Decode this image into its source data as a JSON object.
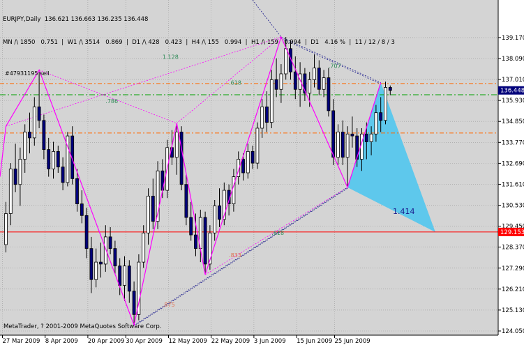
{
  "header": {
    "line1": "EURJPY,Daily  136.621 136.663 136.235 136.448",
    "line2": "MN /\\ 1850   0.751  |  W1 /\\ 3514   0.869  |  D1 /\\ 428   0.423  |  H4 /\\ 155   0.994  |  H1 /\\ 159   0.994  |  D1   4.16 %  |  11 / 12 / 8 / 3"
  },
  "copyright": "MetaTrader, ? 2001-2009 MetaQuotes Software Corp.",
  "order_label": "#47931195 sell",
  "colors": {
    "background_plot": "#d4d4d4",
    "grid": "#9a9a9a",
    "bull_candle": "#ffffff",
    "bear_candle": "#00007a",
    "pattern_line": "#ff00ff",
    "projection_fill": "#5ec8ec",
    "current_price_bg": "#00007a",
    "red_level_bg": "#ff0000",
    "orange_dash": "#ff6a00",
    "green_dash": "#00a000"
  },
  "chart_data": {
    "type": "candlestick",
    "symbol": "EURJPY",
    "timeframe": "Daily",
    "ylim": [
      124.05,
      140.1
    ],
    "y_ticks": [
      "139.170",
      "138.090",
      "137.010",
      "135.930",
      "134.850",
      "133.770",
      "132.690",
      "131.610",
      "130.530",
      "129.450",
      "128.370",
      "127.290",
      "126.210",
      "125.130",
      "124.050"
    ],
    "x_ticks": [
      "27 Mar 2009",
      "8 Apr 2009",
      "20 Apr 2009",
      "30 Apr 2009",
      "12 May 2009",
      "22 May 2009",
      "3 Jun 2009",
      "15 Jun 2009",
      "25 Jun 2009"
    ],
    "current_price": "136.448",
    "red_level": "129.153",
    "levels": {
      "red": 129.153,
      "orange_upper": 136.8,
      "orange_lower": 134.25,
      "green": 136.22
    },
    "fib_labels": [
      {
        "text": "1.128",
        "price": 138.08,
        "bar": 33
      },
      {
        "text": ".707",
        "price": 137.6,
        "bar": 68
      },
      {
        "text": ".618",
        "price": 136.75,
        "bar": 47
      },
      {
        "text": ".786",
        "price": 135.8,
        "bar": 21
      },
      {
        "text": ".618",
        "price": 129.0,
        "bar": 56
      },
      {
        "text": ".833",
        "price": 127.85,
        "bar": 47
      },
      {
        "text": ".875",
        "price": 125.3,
        "bar": 33
      }
    ],
    "projection_label": "1.414",
    "zigzag": [
      {
        "bar": 0,
        "price": 134.6
      },
      {
        "bar": 7,
        "price": 137.5
      },
      {
        "bar": 27,
        "price": 124.35
      },
      {
        "bar": 36,
        "price": 134.75
      },
      {
        "bar": 42,
        "price": 126.95
      },
      {
        "bar": 58,
        "price": 139.2
      },
      {
        "bar": 72,
        "price": 131.45
      },
      {
        "bar": 79,
        "price": 136.85
      }
    ],
    "projection_triangle": [
      {
        "bar": 72,
        "price": 131.45
      },
      {
        "bar": 79,
        "price": 136.85
      },
      {
        "bar": 90.5,
        "price": 129.15
      }
    ],
    "candles": [
      {
        "o": 128.5,
        "h": 130.7,
        "l": 128.1,
        "c": 130.1
      },
      {
        "o": 130.1,
        "h": 132.7,
        "l": 129.5,
        "c": 132.4
      },
      {
        "o": 132.4,
        "h": 133.7,
        "l": 131.2,
        "c": 131.6
      },
      {
        "o": 131.6,
        "h": 133.5,
        "l": 130.5,
        "c": 132.9
      },
      {
        "o": 132.9,
        "h": 134.7,
        "l": 132.2,
        "c": 134.3
      },
      {
        "o": 134.3,
        "h": 135.3,
        "l": 133.2,
        "c": 134.0
      },
      {
        "o": 134.0,
        "h": 136.1,
        "l": 133.6,
        "c": 135.6
      },
      {
        "o": 135.6,
        "h": 137.4,
        "l": 134.5,
        "c": 134.9
      },
      {
        "o": 134.9,
        "h": 135.2,
        "l": 132.9,
        "c": 133.4
      },
      {
        "o": 133.4,
        "h": 134.0,
        "l": 132.0,
        "c": 132.4
      },
      {
        "o": 132.4,
        "h": 133.8,
        "l": 131.9,
        "c": 133.3
      },
      {
        "o": 133.3,
        "h": 133.6,
        "l": 132.2,
        "c": 132.5
      },
      {
        "o": 132.5,
        "h": 133.0,
        "l": 131.3,
        "c": 131.7
      },
      {
        "o": 131.7,
        "h": 134.3,
        "l": 131.5,
        "c": 134.1
      },
      {
        "o": 134.1,
        "h": 134.6,
        "l": 131.6,
        "c": 131.9
      },
      {
        "o": 131.9,
        "h": 132.4,
        "l": 130.2,
        "c": 130.6
      },
      {
        "o": 130.6,
        "h": 131.3,
        "l": 129.6,
        "c": 130.0
      },
      {
        "o": 130.0,
        "h": 130.4,
        "l": 127.8,
        "c": 128.3
      },
      {
        "o": 128.3,
        "h": 128.9,
        "l": 126.0,
        "c": 126.7
      },
      {
        "o": 126.7,
        "h": 128.3,
        "l": 126.3,
        "c": 127.6
      },
      {
        "o": 127.6,
        "h": 128.6,
        "l": 126.8,
        "c": 127.5
      },
      {
        "o": 127.5,
        "h": 129.5,
        "l": 127.1,
        "c": 128.9
      },
      {
        "o": 128.9,
        "h": 129.4,
        "l": 128.0,
        "c": 128.3
      },
      {
        "o": 128.3,
        "h": 128.7,
        "l": 127.0,
        "c": 127.4
      },
      {
        "o": 127.4,
        "h": 127.8,
        "l": 125.9,
        "c": 126.4
      },
      {
        "o": 126.4,
        "h": 127.9,
        "l": 125.6,
        "c": 127.4
      },
      {
        "o": 127.4,
        "h": 127.7,
        "l": 125.5,
        "c": 126.1
      },
      {
        "o": 126.1,
        "h": 126.6,
        "l": 124.4,
        "c": 124.9
      },
      {
        "o": 124.9,
        "h": 128.0,
        "l": 124.6,
        "c": 127.6
      },
      {
        "o": 127.6,
        "h": 129.5,
        "l": 127.3,
        "c": 129.1
      },
      {
        "o": 129.1,
        "h": 131.4,
        "l": 128.5,
        "c": 131.0
      },
      {
        "o": 131.0,
        "h": 131.9,
        "l": 129.3,
        "c": 129.7
      },
      {
        "o": 129.7,
        "h": 132.8,
        "l": 129.3,
        "c": 132.3
      },
      {
        "o": 132.3,
        "h": 132.9,
        "l": 130.9,
        "c": 131.3
      },
      {
        "o": 131.3,
        "h": 133.9,
        "l": 130.9,
        "c": 133.5
      },
      {
        "o": 133.5,
        "h": 134.4,
        "l": 132.6,
        "c": 133.0
      },
      {
        "o": 133.0,
        "h": 134.7,
        "l": 132.1,
        "c": 134.3
      },
      {
        "o": 134.3,
        "h": 134.6,
        "l": 131.3,
        "c": 131.6
      },
      {
        "o": 131.6,
        "h": 132.1,
        "l": 129.5,
        "c": 129.9
      },
      {
        "o": 129.9,
        "h": 130.7,
        "l": 128.7,
        "c": 129.0
      },
      {
        "o": 129.0,
        "h": 130.1,
        "l": 127.9,
        "c": 128.3
      },
      {
        "o": 128.3,
        "h": 130.3,
        "l": 127.6,
        "c": 129.9
      },
      {
        "o": 129.9,
        "h": 130.2,
        "l": 127.0,
        "c": 127.5
      },
      {
        "o": 127.5,
        "h": 129.5,
        "l": 127.2,
        "c": 129.1
      },
      {
        "o": 129.1,
        "h": 130.8,
        "l": 128.7,
        "c": 130.5
      },
      {
        "o": 130.5,
        "h": 131.4,
        "l": 129.4,
        "c": 129.8
      },
      {
        "o": 129.8,
        "h": 131.7,
        "l": 129.5,
        "c": 131.3
      },
      {
        "o": 131.3,
        "h": 131.6,
        "l": 130.0,
        "c": 130.6
      },
      {
        "o": 130.6,
        "h": 132.4,
        "l": 130.2,
        "c": 132.0
      },
      {
        "o": 132.0,
        "h": 133.3,
        "l": 131.6,
        "c": 132.9
      },
      {
        "o": 132.9,
        "h": 133.2,
        "l": 131.8,
        "c": 132.2
      },
      {
        "o": 132.2,
        "h": 133.7,
        "l": 131.9,
        "c": 133.3
      },
      {
        "o": 133.3,
        "h": 133.6,
        "l": 132.4,
        "c": 132.7
      },
      {
        "o": 132.7,
        "h": 134.8,
        "l": 132.4,
        "c": 134.5
      },
      {
        "o": 134.5,
        "h": 136.0,
        "l": 134.0,
        "c": 135.6
      },
      {
        "o": 135.6,
        "h": 136.4,
        "l": 134.3,
        "c": 134.8
      },
      {
        "o": 134.8,
        "h": 137.5,
        "l": 134.5,
        "c": 137.0
      },
      {
        "o": 137.0,
        "h": 138.1,
        "l": 136.1,
        "c": 136.5
      },
      {
        "o": 136.5,
        "h": 137.8,
        "l": 135.8,
        "c": 137.3
      },
      {
        "o": 137.3,
        "h": 139.2,
        "l": 137.0,
        "c": 138.6
      },
      {
        "o": 138.6,
        "h": 139.0,
        "l": 137.0,
        "c": 137.4
      },
      {
        "o": 137.4,
        "h": 138.2,
        "l": 136.0,
        "c": 136.5
      },
      {
        "o": 136.5,
        "h": 137.9,
        "l": 135.6,
        "c": 137.3
      },
      {
        "o": 137.3,
        "h": 137.6,
        "l": 135.9,
        "c": 136.3
      },
      {
        "o": 136.3,
        "h": 137.4,
        "l": 135.6,
        "c": 137.0
      },
      {
        "o": 137.0,
        "h": 138.3,
        "l": 136.6,
        "c": 137.6
      },
      {
        "o": 137.6,
        "h": 138.0,
        "l": 136.2,
        "c": 136.5
      },
      {
        "o": 136.5,
        "h": 137.5,
        "l": 136.1,
        "c": 137.1
      },
      {
        "o": 137.1,
        "h": 137.6,
        "l": 135.1,
        "c": 135.4
      },
      {
        "o": 135.4,
        "h": 136.0,
        "l": 132.6,
        "c": 133.0
      },
      {
        "o": 133.0,
        "h": 134.7,
        "l": 132.6,
        "c": 134.3
      },
      {
        "o": 134.3,
        "h": 134.9,
        "l": 132.6,
        "c": 133.0
      },
      {
        "o": 133.0,
        "h": 134.6,
        "l": 131.5,
        "c": 134.2
      },
      {
        "o": 134.2,
        "h": 135.1,
        "l": 133.5,
        "c": 134.1
      },
      {
        "o": 134.1,
        "h": 134.5,
        "l": 132.5,
        "c": 132.9
      },
      {
        "o": 132.9,
        "h": 134.5,
        "l": 132.3,
        "c": 134.2
      },
      {
        "o": 134.2,
        "h": 134.8,
        "l": 132.9,
        "c": 133.8
      },
      {
        "o": 133.8,
        "h": 134.6,
        "l": 133.1,
        "c": 134.2
      },
      {
        "o": 134.2,
        "h": 135.7,
        "l": 133.8,
        "c": 135.3
      },
      {
        "o": 135.3,
        "h": 136.1,
        "l": 134.3,
        "c": 134.9
      },
      {
        "o": 134.9,
        "h": 136.9,
        "l": 134.7,
        "c": 136.6
      },
      {
        "o": 136.6,
        "h": 136.7,
        "l": 136.2,
        "c": 136.45
      }
    ]
  }
}
